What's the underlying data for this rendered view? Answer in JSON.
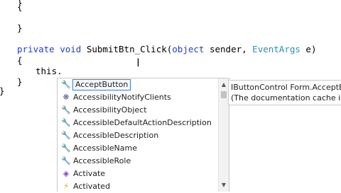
{
  "editor": {
    "lines": [
      {
        "text": "{"
      },
      {
        "text": "}"
      },
      {
        "keyword1": "private",
        "keyword2": "void",
        "method": "SubmitBtn_Click(",
        "keyword3": "object",
        "param1": " sender, ",
        "type": "EventArgs",
        "param2": " e)"
      },
      {
        "text": "{"
      },
      {
        "text": "this."
      },
      {
        "text": "}"
      },
      {
        "text": "}"
      }
    ]
  },
  "completion": {
    "items": [
      {
        "label": "AcceptButton",
        "icon": "wrench-icon",
        "selected": true
      },
      {
        "label": "AccessibilityNotifyClients",
        "icon": "extension-method-icon"
      },
      {
        "label": "AccessibilityObject",
        "icon": "wrench-icon"
      },
      {
        "label": "AccessibleDefaultActionDescription",
        "icon": "wrench-icon"
      },
      {
        "label": "AccessibleDescription",
        "icon": "wrench-icon"
      },
      {
        "label": "AccessibleName",
        "icon": "wrench-icon"
      },
      {
        "label": "AccessibleRole",
        "icon": "wrench-icon"
      },
      {
        "label": "Activate",
        "icon": "method-icon"
      },
      {
        "label": "Activated",
        "icon": "event-icon"
      }
    ]
  },
  "tooltip": {
    "line1": "IButtonControl Form.AcceptButt",
    "line2": "(The documentation cache is st"
  },
  "colors": {
    "keyword": "#1f3fd6",
    "type": "#2b91af",
    "selection_border": "#3d7bd3"
  }
}
